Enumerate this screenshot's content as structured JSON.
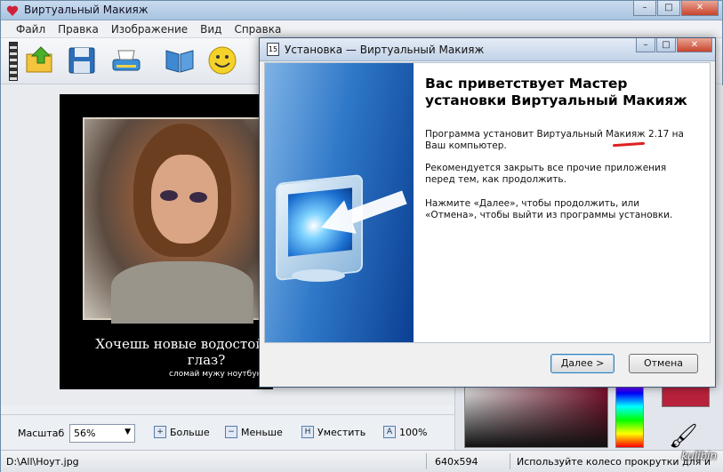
{
  "app": {
    "title": "Виртуальный Макияж",
    "menu": [
      "Файл",
      "Правка",
      "Изображение",
      "Вид",
      "Справка"
    ]
  },
  "toolbar": {
    "buttons": [
      "open-icon",
      "save-icon",
      "scan-icon",
      "book-icon",
      "smile-icon"
    ]
  },
  "canvas": {
    "caption_line1": "Хочешь новые водостойк",
    "caption_line2": "глаз?",
    "caption_line3": "сломай мужу ноутбук"
  },
  "bottom": {
    "zoom_label": "Масштаб",
    "zoom_value": "56%",
    "more_label": "Больше",
    "less_label": "Меньше",
    "fit_label": "Уместить",
    "actual_label": "100%"
  },
  "status": {
    "path": "D:\\All\\Ноут.jpg",
    "size": "640x594",
    "hint": "Используйте колесо прокрутки для и"
  },
  "watermark": "kulibin",
  "dialog": {
    "title": "Установка — Виртуальный Макияж",
    "heading": "Вас приветствует Мастер установки Виртуальный Макияж",
    "p1": "Программа установит Виртуальный Макияж 2.17 на Ваш компьютер.",
    "p2": "Рекомендуется закрыть все прочие приложения перед тем, как продолжить.",
    "p3": "Нажмите «Далее», чтобы продолжить, или «Отмена», чтобы выйти из программы установки.",
    "next_label": "Далее >",
    "cancel_label": "Отмена"
  },
  "colors": {
    "accent_swatch": "#b8213b",
    "highlight_underline": "#e02020"
  }
}
